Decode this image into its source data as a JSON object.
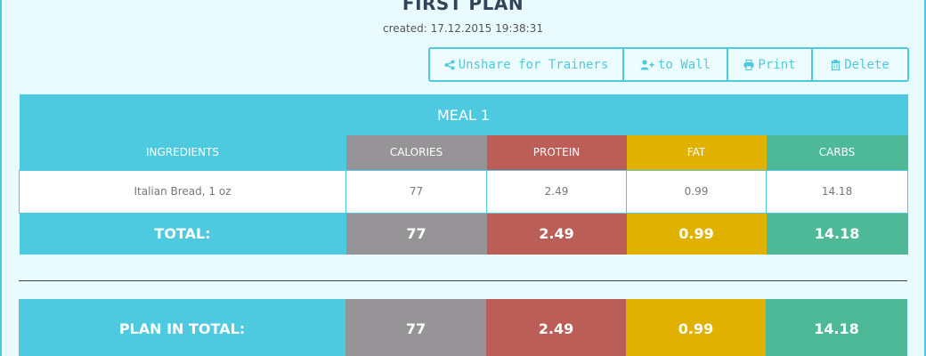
{
  "plan": {
    "title": "FIRST PLAN",
    "created": "created: 17.12.2015 19:38:31"
  },
  "actions": {
    "unshare_label": "Unshare for Trainers",
    "to_wall_label": "to Wall",
    "print_label": "Print",
    "delete_label": "Delete"
  },
  "meal": {
    "title": "MEAL 1",
    "columns": [
      "INGREDIENTS",
      "CALORIES",
      "PROTEIN",
      "FAT",
      "CARBS"
    ],
    "rows": [
      {
        "ingredient": "Italian Bread, 1 oz",
        "calories": "77",
        "protein": "2.49",
        "fat": "0.99",
        "carbs": "14.18"
      }
    ],
    "total": {
      "label": "TOTAL:",
      "calories": "77",
      "protein": "2.49",
      "fat": "0.99",
      "carbs": "14.18"
    }
  },
  "plan_total": {
    "label": "PLAN IN TOTAL:",
    "calories": "77",
    "protein": "2.49",
    "fat": "0.99",
    "carbs": "14.18"
  },
  "colors": {
    "accent": "#4dcadf",
    "calories": "#979498",
    "protein": "#bb5e57",
    "fat": "#e1b100",
    "carbs": "#4db996",
    "background": "#e9fbfe"
  },
  "icons": {
    "unshare": "share-icon",
    "to_wall": "user-plus-icon",
    "print": "print-icon",
    "delete": "trash-icon"
  }
}
